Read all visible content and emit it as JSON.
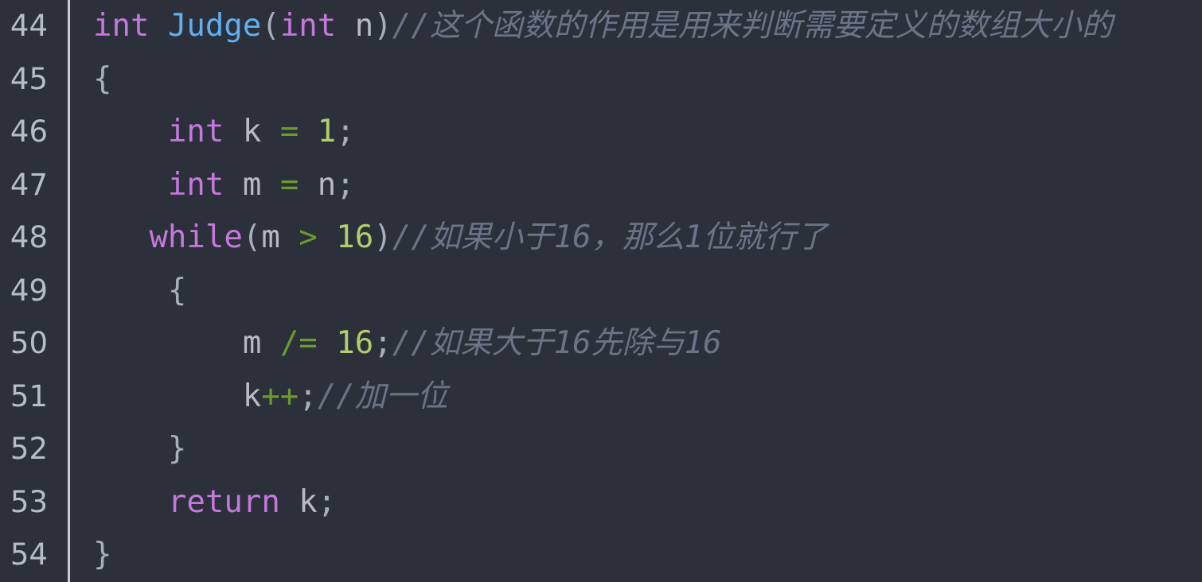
{
  "editor": {
    "name": "code-editor",
    "language": "c",
    "theme": {
      "background": "#2b303b",
      "gutter_separator": "#c7ccd6",
      "line_number_color": "#b6bdc9",
      "keyword_color": "#c678dd",
      "function_color": "#61afef",
      "operator_color": "#6a9b2e",
      "number_color": "#b5cc6a",
      "comment_color": "#6b7486",
      "plain_color": "#b5bac4"
    },
    "first_line_number": 44,
    "last_line_number": 54,
    "line_numbers": [
      "44",
      "45",
      "46",
      "47",
      "48",
      "49",
      "50",
      "51",
      "52",
      "53",
      "54"
    ],
    "lines": [
      {
        "number": "44",
        "text": "int Judge(int n)//这个函数的作用是用来判断需要定义的数组大小的",
        "tokens": [
          {
            "t": "int",
            "c": "kw"
          },
          {
            "t": " ",
            "c": "plain"
          },
          {
            "t": "Judge",
            "c": "fn"
          },
          {
            "t": "(",
            "c": "punct"
          },
          {
            "t": "int",
            "c": "kw"
          },
          {
            "t": " n",
            "c": "plain"
          },
          {
            "t": ")",
            "c": "punct"
          },
          {
            "t": "//这个函数的作用是用来判断需要定义的数组大小的",
            "c": "comment"
          }
        ]
      },
      {
        "number": "45",
        "text": "{",
        "tokens": [
          {
            "t": "{",
            "c": "punct"
          }
        ]
      },
      {
        "number": "46",
        "text": "    int k = 1;",
        "tokens": [
          {
            "t": "    ",
            "c": "plain"
          },
          {
            "t": "int",
            "c": "kw"
          },
          {
            "t": " k ",
            "c": "plain"
          },
          {
            "t": "=",
            "c": "op"
          },
          {
            "t": " ",
            "c": "plain"
          },
          {
            "t": "1",
            "c": "num"
          },
          {
            "t": ";",
            "c": "punct"
          }
        ]
      },
      {
        "number": "47",
        "text": "    int m = n;",
        "tokens": [
          {
            "t": "    ",
            "c": "plain"
          },
          {
            "t": "int",
            "c": "kw"
          },
          {
            "t": " m ",
            "c": "plain"
          },
          {
            "t": "=",
            "c": "op"
          },
          {
            "t": " n",
            "c": "plain"
          },
          {
            "t": ";",
            "c": "punct"
          }
        ]
      },
      {
        "number": "48",
        "text": "   while(m > 16)//如果小于16，那么1位就行了",
        "tokens": [
          {
            "t": "   ",
            "c": "plain"
          },
          {
            "t": "while",
            "c": "kw"
          },
          {
            "t": "(",
            "c": "punct"
          },
          {
            "t": "m ",
            "c": "plain"
          },
          {
            "t": ">",
            "c": "op"
          },
          {
            "t": " ",
            "c": "plain"
          },
          {
            "t": "16",
            "c": "num"
          },
          {
            "t": ")",
            "c": "punct"
          },
          {
            "t": "//如果小于16，那么1位就行了",
            "c": "comment"
          }
        ]
      },
      {
        "number": "49",
        "text": "    {",
        "tokens": [
          {
            "t": "    ",
            "c": "plain"
          },
          {
            "t": "{",
            "c": "punct"
          }
        ]
      },
      {
        "number": "50",
        "text": "        m /= 16;//如果大于16先除与16",
        "tokens": [
          {
            "t": "        ",
            "c": "plain"
          },
          {
            "t": "m ",
            "c": "plain"
          },
          {
            "t": "/=",
            "c": "op"
          },
          {
            "t": " ",
            "c": "plain"
          },
          {
            "t": "16",
            "c": "num"
          },
          {
            "t": ";",
            "c": "punct"
          },
          {
            "t": "//如果大于16先除与16",
            "c": "comment"
          }
        ]
      },
      {
        "number": "51",
        "text": "        k++;//加一位",
        "tokens": [
          {
            "t": "        ",
            "c": "plain"
          },
          {
            "t": "k",
            "c": "plain"
          },
          {
            "t": "++",
            "c": "op"
          },
          {
            "t": ";",
            "c": "punct"
          },
          {
            "t": "//加一位",
            "c": "comment"
          }
        ]
      },
      {
        "number": "52",
        "text": "    }",
        "tokens": [
          {
            "t": "    ",
            "c": "plain"
          },
          {
            "t": "}",
            "c": "punct"
          }
        ]
      },
      {
        "number": "53",
        "text": "    return k;",
        "tokens": [
          {
            "t": "    ",
            "c": "plain"
          },
          {
            "t": "return",
            "c": "kw"
          },
          {
            "t": " k",
            "c": "plain"
          },
          {
            "t": ";",
            "c": "punct"
          }
        ]
      },
      {
        "number": "54",
        "text": "}",
        "tokens": [
          {
            "t": "}",
            "c": "punct"
          }
        ]
      }
    ]
  }
}
